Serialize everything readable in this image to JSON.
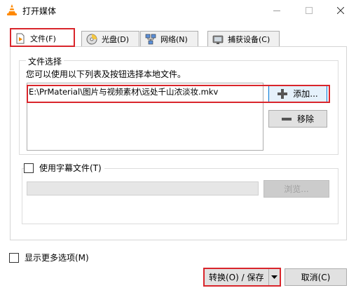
{
  "window": {
    "title": "打开媒体",
    "app_icon": "vlc-cone-icon"
  },
  "tabs": [
    {
      "label": "文件(F)",
      "icon": "file-play-icon",
      "active": true
    },
    {
      "label": "光盘(D)",
      "icon": "disc-icon",
      "active": false
    },
    {
      "label": "网络(N)",
      "icon": "network-icon",
      "active": false
    },
    {
      "label": "捕获设备(C)",
      "icon": "capture-device-icon",
      "active": false
    }
  ],
  "file_selection": {
    "legend": "文件选择",
    "description": "您可以使用以下列表及按钮选择本地文件。",
    "files": [
      "E:\\PrMaterial\\图片与视频素材\\远处千山浓淡妆.mkv"
    ],
    "add_label": "添加...",
    "remove_label": "移除"
  },
  "subtitle": {
    "checkbox_label": "使用字幕文件(T)",
    "checked": false,
    "path_value": "",
    "browse_label": "浏览..."
  },
  "more_options": {
    "label": "显示更多选项(M)",
    "checked": false
  },
  "footer": {
    "convert_label": "转换(O) / 保存",
    "cancel_label": "取消(C)"
  },
  "colors": {
    "highlight": "#d9252b",
    "accent": "#0078d7"
  }
}
